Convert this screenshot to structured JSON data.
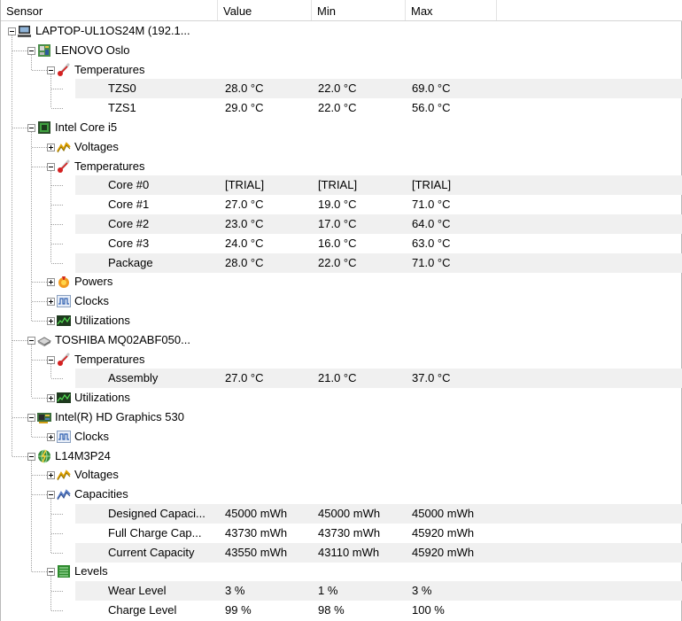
{
  "header": {
    "sensor": "Sensor",
    "value": "Value",
    "min": "Min",
    "max": "Max"
  },
  "tree": [
    {
      "id": "laptop",
      "depth": 0,
      "expander": "minus",
      "icon": "computer-icon",
      "label": "LAPTOP-UL1OS24M (192.1..."
    },
    {
      "id": "lenovo",
      "depth": 1,
      "expander": "minus",
      "icon": "motherboard-icon",
      "label": "LENOVO Oslo"
    },
    {
      "id": "lenovo-temps",
      "depth": 2,
      "expander": "minus",
      "icon": "thermometer-icon",
      "label": "Temperatures"
    },
    {
      "id": "tzs0",
      "depth": 3,
      "label": "TZS0",
      "value": "28.0 °C",
      "min": "22.0 °C",
      "max": "69.0 °C",
      "shade": true
    },
    {
      "id": "tzs1",
      "depth": 3,
      "label": "TZS1",
      "value": "29.0 °C",
      "min": "22.0 °C",
      "max": "56.0 °C"
    },
    {
      "id": "cpu",
      "depth": 1,
      "expander": "minus",
      "icon": "cpu-icon",
      "label": "Intel Core i5"
    },
    {
      "id": "cpu-volt",
      "depth": 2,
      "expander": "plus",
      "icon": "voltage-icon",
      "label": "Voltages"
    },
    {
      "id": "cpu-temps",
      "depth": 2,
      "expander": "minus",
      "icon": "thermometer-icon",
      "label": "Temperatures"
    },
    {
      "id": "core0",
      "depth": 3,
      "label": "Core #0",
      "value": "[TRIAL]",
      "min": "[TRIAL]",
      "max": "[TRIAL]",
      "shade": true
    },
    {
      "id": "core1",
      "depth": 3,
      "label": "Core #1",
      "value": "27.0 °C",
      "min": "19.0 °C",
      "max": "71.0 °C"
    },
    {
      "id": "core2",
      "depth": 3,
      "label": "Core #2",
      "value": "23.0 °C",
      "min": "17.0 °C",
      "max": "64.0 °C",
      "shade": true
    },
    {
      "id": "core3",
      "depth": 3,
      "label": "Core #3",
      "value": "24.0 °C",
      "min": "16.0 °C",
      "max": "63.0 °C"
    },
    {
      "id": "package",
      "depth": 3,
      "label": "Package",
      "value": "28.0 °C",
      "min": "22.0 °C",
      "max": "71.0 °C",
      "shade": true
    },
    {
      "id": "cpu-powers",
      "depth": 2,
      "expander": "plus",
      "icon": "power-icon",
      "label": "Powers"
    },
    {
      "id": "cpu-clocks",
      "depth": 2,
      "expander": "plus",
      "icon": "clock-icon",
      "label": "Clocks"
    },
    {
      "id": "cpu-util",
      "depth": 2,
      "expander": "plus",
      "icon": "utilization-icon",
      "label": "Utilizations"
    },
    {
      "id": "hdd",
      "depth": 1,
      "expander": "minus",
      "icon": "disk-icon",
      "label": "TOSHIBA MQ02ABF050..."
    },
    {
      "id": "hdd-temps",
      "depth": 2,
      "expander": "minus",
      "icon": "thermometer-icon",
      "label": "Temperatures"
    },
    {
      "id": "assembly",
      "depth": 3,
      "label": "Assembly",
      "value": "27.0 °C",
      "min": "21.0 °C",
      "max": "37.0 °C",
      "shade": true
    },
    {
      "id": "hdd-util",
      "depth": 2,
      "expander": "plus",
      "icon": "utilization-icon",
      "label": "Utilizations"
    },
    {
      "id": "gpu",
      "depth": 1,
      "expander": "minus",
      "icon": "gpu-icon",
      "label": "Intel(R) HD Graphics 530"
    },
    {
      "id": "gpu-clocks",
      "depth": 2,
      "expander": "plus",
      "icon": "clock-icon",
      "label": "Clocks"
    },
    {
      "id": "battery",
      "depth": 1,
      "expander": "minus",
      "icon": "battery-icon",
      "label": "L14M3P24"
    },
    {
      "id": "bat-volt",
      "depth": 2,
      "expander": "plus",
      "icon": "voltage-icon",
      "label": "Voltages"
    },
    {
      "id": "bat-cap",
      "depth": 2,
      "expander": "minus",
      "icon": "capacity-icon",
      "label": "Capacities"
    },
    {
      "id": "designed",
      "depth": 3,
      "label": "Designed Capaci...",
      "value": "45000 mWh",
      "min": "45000 mWh",
      "max": "45000 mWh",
      "shade": true
    },
    {
      "id": "fullcharge",
      "depth": 3,
      "label": "Full Charge Cap...",
      "value": "43730 mWh",
      "min": "43730 mWh",
      "max": "45920 mWh"
    },
    {
      "id": "current",
      "depth": 3,
      "label": "Current Capacity",
      "value": "43550 mWh",
      "min": "43110 mWh",
      "max": "45920 mWh",
      "shade": true
    },
    {
      "id": "levels",
      "depth": 2,
      "expander": "minus",
      "icon": "level-icon",
      "label": "Levels"
    },
    {
      "id": "wear",
      "depth": 3,
      "label": "Wear Level",
      "value": "3 %",
      "min": "1 %",
      "max": "3 %",
      "shade": true
    },
    {
      "id": "charge",
      "depth": 3,
      "label": "Charge Level",
      "value": "99 %",
      "min": "98 %",
      "max": "100 %"
    }
  ],
  "colors": {
    "shade": "#f0f0f0",
    "header_border": "#d5d5d5",
    "tree_line": "#a0a0a0"
  }
}
